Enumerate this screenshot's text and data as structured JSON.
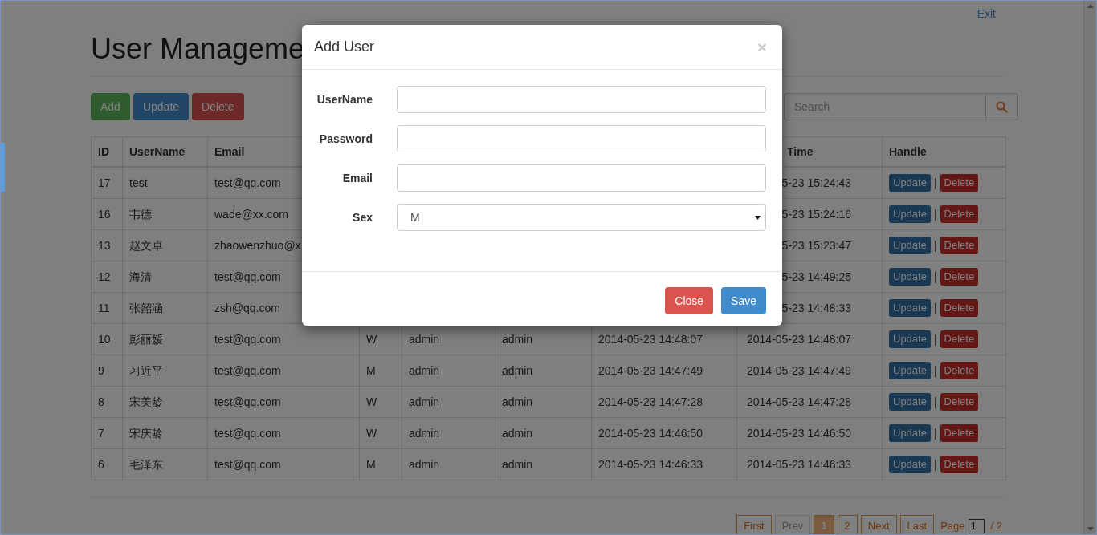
{
  "top_link": "Exit",
  "page_title": "User Manageme",
  "actions": [
    {
      "label": "Add",
      "kind": "success"
    },
    {
      "label": "Update",
      "kind": "primary"
    },
    {
      "label": "Delete",
      "kind": "danger"
    }
  ],
  "search": {
    "placeholder": "Search"
  },
  "table": {
    "headers": {
      "id": "ID",
      "username": "UserName",
      "email": "Email",
      "column_8": "Time",
      "handle": "Handle"
    },
    "rows": [
      {
        "id": "17",
        "username": "test",
        "email": "test@qq.com",
        "column_8": "5-23 15:24:43",
        "update": "Update",
        "separator": "|",
        "delete": "Delete"
      },
      {
        "id": "16",
        "username": "韦德",
        "email": "wade@xx.com",
        "column_8": "5-23 15:24:16",
        "update": "Update",
        "separator": "|",
        "delete": "Delete"
      },
      {
        "id": "13",
        "username": "赵文卓",
        "email": "zhaowenzhuo@x",
        "column_8": "5-23 15:23:47",
        "update": "Update",
        "separator": "|",
        "delete": "Delete"
      },
      {
        "id": "12",
        "username": "海清",
        "email": "test@qq.com",
        "column_8": "5-23 14:49:25",
        "update": "Update",
        "separator": "|",
        "delete": "Delete"
      },
      {
        "id": "11",
        "username": "张韶涵",
        "email": "zsh@qq.com",
        "column_8": "5-23 14:48:33",
        "update": "Update",
        "separator": "|",
        "delete": "Delete"
      },
      {
        "id": "10",
        "username": "彭丽媛",
        "email": "test@qq.com",
        "sex": "W",
        "column_5": "admin",
        "column_6": "admin",
        "column_7": "2014-05-23 14:48:07",
        "column_8": "2014-05-23 14:48:07",
        "update": "Update",
        "separator": "|",
        "delete": "Delete"
      },
      {
        "id": "9",
        "username": "习近平",
        "email": "test@qq.com",
        "sex": "M",
        "column_5": "admin",
        "column_6": "admin",
        "column_7": "2014-05-23 14:47:49",
        "column_8": "2014-05-23 14:47:49",
        "update": "Update",
        "separator": "|",
        "delete": "Delete"
      },
      {
        "id": "8",
        "username": "宋美龄",
        "email": "test@qq.com",
        "sex": "W",
        "column_5": "admin",
        "column_6": "admin",
        "column_7": "2014-05-23 14:47:28",
        "column_8": "2014-05-23 14:47:28",
        "update": "Update",
        "separator": "|",
        "delete": "Delete"
      },
      {
        "id": "7",
        "username": "宋庆龄",
        "email": "test@qq.com",
        "sex": "W",
        "column_5": "admin",
        "column_6": "admin",
        "column_7": "2014-05-23 14:46:50",
        "column_8": "2014-05-23 14:46:50",
        "update": "Update",
        "separator": "|",
        "delete": "Delete"
      },
      {
        "id": "6",
        "username": "毛泽东",
        "email": "test@qq.com",
        "sex": "M",
        "column_5": "admin",
        "column_6": "admin",
        "column_7": "2014-05-23 14:46:33",
        "column_8": "2014-05-23 14:46:33",
        "update": "Update",
        "separator": "|",
        "delete": "Delete"
      }
    ]
  },
  "pagination": {
    "items": [
      {
        "label": "First",
        "selected": false,
        "disabled": false
      },
      {
        "label": "Prev",
        "selected": false,
        "disabled": true
      },
      {
        "label": "1",
        "selected": true,
        "disabled": false
      },
      {
        "label": "2",
        "selected": false,
        "disabled": false
      },
      {
        "label": "Next",
        "selected": false,
        "disabled": false
      },
      {
        "label": "Last",
        "selected": false,
        "disabled": false
      }
    ],
    "page_label": "Page",
    "page_value": "1",
    "page_total": "/ 2"
  },
  "modal": {
    "title": "Add User",
    "close_icon": "×",
    "fields": [
      {
        "label": "UserName",
        "kind": "text"
      },
      {
        "label": "Password",
        "kind": "text"
      },
      {
        "label": "Email",
        "kind": "text"
      },
      {
        "label": "Sex",
        "kind": "select",
        "value": "M"
      }
    ],
    "buttons": [
      {
        "label": "Close",
        "kind": "danger"
      },
      {
        "label": "Save",
        "kind": "primary"
      }
    ]
  }
}
